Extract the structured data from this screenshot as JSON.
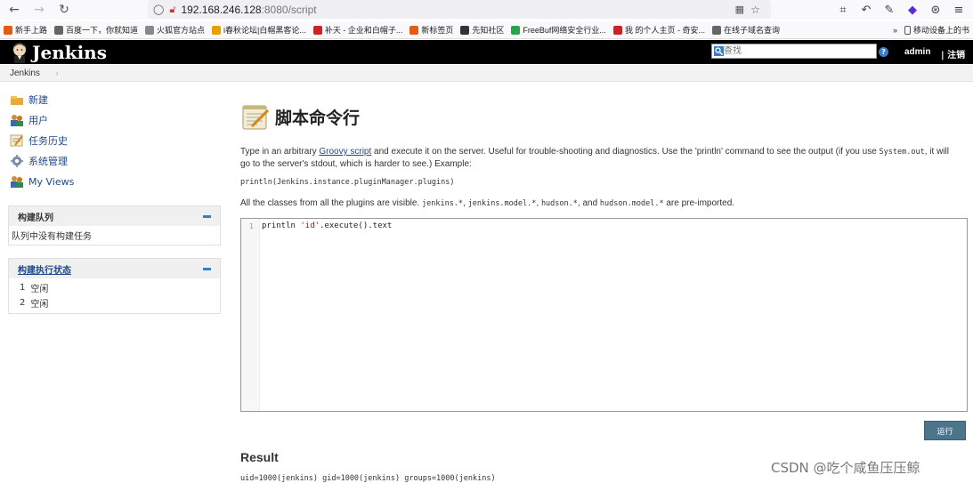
{
  "browser": {
    "url_host": "192.168.246.128",
    "url_rest": ":8080/script",
    "bookmarks": [
      {
        "label": "新手上路",
        "color": "#e55b13"
      },
      {
        "label": "百度一下，你就知道",
        "color": "#666666"
      },
      {
        "label": "火狐官方站点",
        "color": "#888888"
      },
      {
        "label": "i春秋论坛|白帽黑客论...",
        "color": "#e8a000"
      },
      {
        "label": "补天 - 企业和白帽子...",
        "color": "#cc2222"
      },
      {
        "label": "新标签页",
        "color": "#e55b13"
      },
      {
        "label": "先知社区",
        "color": "#333333"
      },
      {
        "label": "FreeBuf网络安全行业...",
        "color": "#2aa34a"
      },
      {
        "label": "我 的个人主页 - 奇安...",
        "color": "#cc2222"
      },
      {
        "label": "在线子域名查询",
        "color": "#666666"
      }
    ],
    "more": "»",
    "mobile": "移动设备上的书"
  },
  "header": {
    "title": "Jenkins",
    "search_placeholder": "查找",
    "user": "admin",
    "logout": "| 注销"
  },
  "breadcrumb": {
    "root": "Jenkins",
    "arrow": "›"
  },
  "sidebar": {
    "tasks": [
      {
        "label": "新建",
        "icon": "new-item-icon"
      },
      {
        "label": "用户",
        "icon": "users-icon"
      },
      {
        "label": "任务历史",
        "icon": "build-history-icon"
      },
      {
        "label": "系统管理",
        "icon": "manage-jenkins-icon"
      },
      {
        "label": "My Views",
        "icon": "my-views-icon"
      }
    ],
    "queue": {
      "title": "构建队列",
      "empty": "队列中没有构建任务"
    },
    "executors": {
      "title": "构建执行状态",
      "rows": [
        {
          "num": "1",
          "status": "空闲"
        },
        {
          "num": "2",
          "status": "空闲"
        }
      ]
    }
  },
  "main": {
    "title": "脚本命令行",
    "desc_pre": "Type in an arbitrary ",
    "desc_link": "Groovy script",
    "desc_mid": " and execute it on the server. Useful for trouble-shooting and diagnostics. Use the 'println' command to see the output (if you use ",
    "desc_code": "System.out",
    "desc_post": ", it will go to the server's stdout, which is harder to see.) Example:",
    "example": "println(Jenkins.instance.pluginManager.plugins)",
    "classes_pre": "All the classes from all the plugins are visible. ",
    "classes_code1": "jenkins.*",
    "classes_code2": "jenkins.model.*",
    "classes_code3": "hudson.*",
    "classes_and": ", and ",
    "classes_code4": "hudson.model.*",
    "classes_post": " are pre-imported.",
    "editor_line": "1",
    "code_pre": "println ",
    "code_str": "'id'",
    "code_post": ".execute().text",
    "run_label": "运行",
    "result_title": "Result",
    "result_output": "uid=1000(jenkins) gid=1000(jenkins) groups=1000(jenkins)"
  },
  "watermark": "CSDN @吃个咸鱼压压鲸"
}
